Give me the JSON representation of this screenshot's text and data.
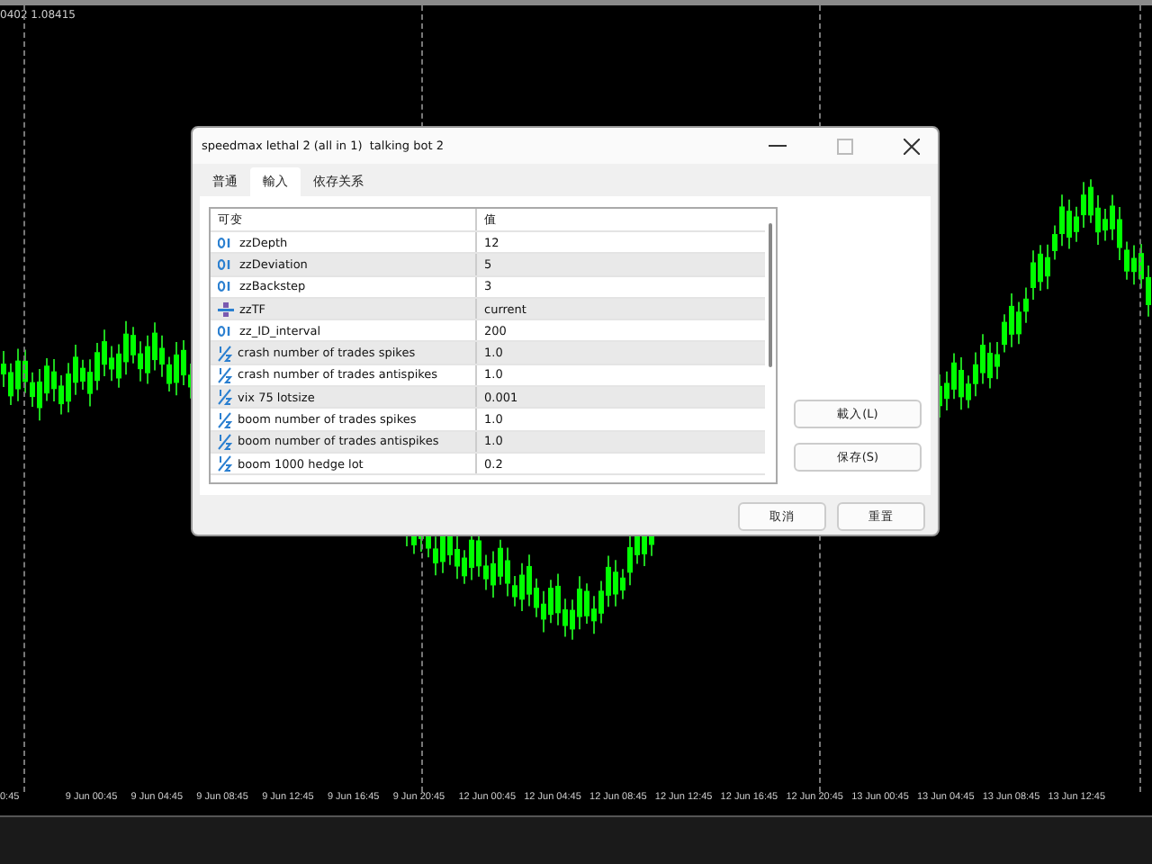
{
  "chart": {
    "price_label": "0402 1.08415",
    "time_labels": [
      "0:45",
      "9 Jun 00:45",
      "9 Jun 04:45",
      "9 Jun 08:45",
      "9 Jun 12:45",
      "9 Jun 16:45",
      "9 Jun 20:45",
      "12 Jun 00:45",
      "12 Jun 04:45",
      "12 Jun 08:45",
      "12 Jun 12:45",
      "12 Jun 16:45",
      "12 Jun 20:45",
      "13 Jun 00:45",
      "13 Jun 04:45",
      "13 Jun 08:45",
      "13 Jun 12:45"
    ]
  },
  "window": {
    "title": "speedmax lethal 2 (all in 1)  talking bot 2"
  },
  "tabs": [
    {
      "label": "普通",
      "selected": false
    },
    {
      "label": "輸入",
      "selected": true
    },
    {
      "label": "依存关系",
      "selected": false
    }
  ],
  "table": {
    "columns": [
      "可变",
      "值"
    ],
    "rows": [
      {
        "kind": "int",
        "name": "zzDepth",
        "value": "12"
      },
      {
        "kind": "int",
        "name": "zzDeviation",
        "value": "5"
      },
      {
        "kind": "int",
        "name": "zzBackstep",
        "value": "3"
      },
      {
        "kind": "enum",
        "name": "zzTF",
        "value": "current"
      },
      {
        "kind": "int",
        "name": "zz_ID_interval",
        "value": "200"
      },
      {
        "kind": "double",
        "name": "crash number of trades spikes",
        "value": "1.0"
      },
      {
        "kind": "double",
        "name": "crash number of trades antispikes",
        "value": "1.0"
      },
      {
        "kind": "double",
        "name": "vix 75 lotsize",
        "value": "0.001"
      },
      {
        "kind": "double",
        "name": "boom number of trades spikes",
        "value": "1.0"
      },
      {
        "kind": "double",
        "name": "boom number of trades antispikes",
        "value": "1.0"
      },
      {
        "kind": "double",
        "name": "boom 1000 hedge lot",
        "value": "0.2"
      }
    ]
  },
  "side_buttons": [
    "載入(L)",
    "保存(S)"
  ],
  "buttons": [
    "取消",
    "重置"
  ]
}
